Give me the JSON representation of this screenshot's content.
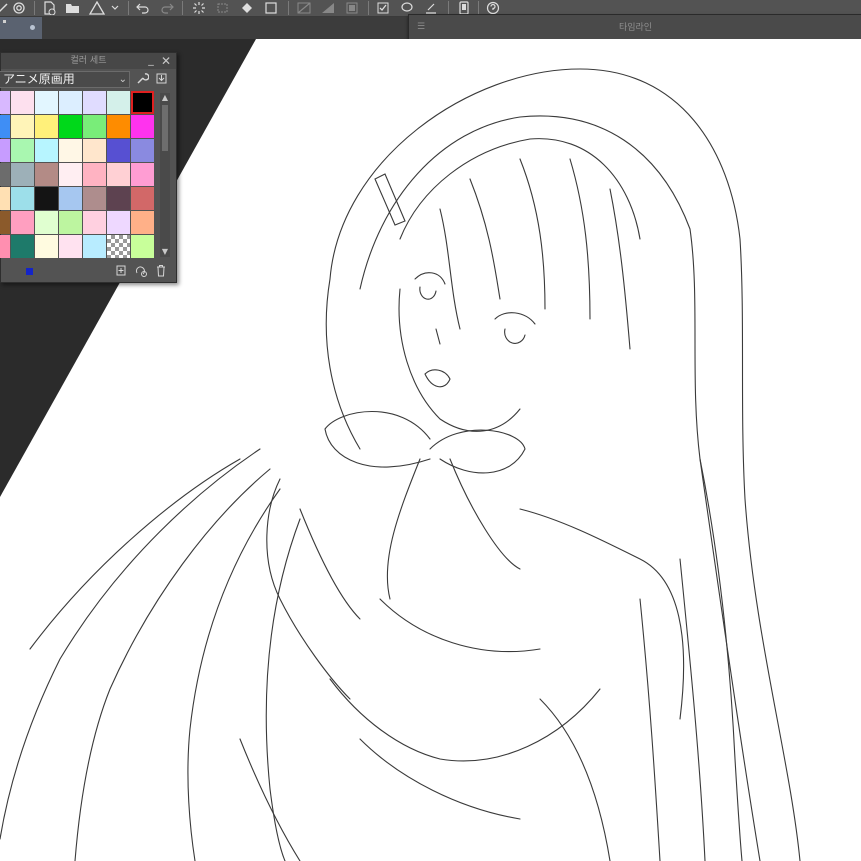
{
  "timeline": {
    "title": "타임라인"
  },
  "palette": {
    "title": "컬러 세트",
    "set_name": "アニメ原画用",
    "current_color": "#1424c8",
    "swatches": [
      "#d8b8ff",
      "#fde0ee",
      "#e2f6ff",
      "#dceeff",
      "#e0dcff",
      "#d4f0ea",
      "#000000",
      "#3f8ef5",
      "#fff4b8",
      "#fff07a",
      "#00d81a",
      "#79ed79",
      "#fe8c00",
      "#ff33ee",
      "#c79cff",
      "#a9f7b0",
      "#b7f5ff",
      "#fff7e6",
      "#ffe6cc",
      "#5750d2",
      "#8a8ae0",
      "#6c6c6c",
      "#9db0b8",
      "#b38b86",
      "#ffeef2",
      "#ffb3c2",
      "#ffd0d4",
      "#ff9dd3",
      "#ffe0b3",
      "#9ddfea",
      "#141414",
      "#a6c7f0",
      "#ae8d8d",
      "#5d4250",
      "#d26868",
      "#8b5a2b",
      "#ff9fc0",
      "#e0ffd0",
      "#bdf5a0",
      "#ffd0e0",
      "#eed8ff",
      "#ffb088",
      "#ff8fb0",
      "#1e7a6a",
      "#fffbe0",
      "#ffe2f0",
      "#b8ecff",
      "transparent",
      "#c8ff9a"
    ],
    "selected_index": 6
  },
  "icons": {
    "toolbar": [
      "pen-icon",
      "spiral-icon",
      "new-file-icon",
      "open-folder-icon",
      "export-icon",
      "dropdown-icon",
      "undo-icon",
      "redo-icon",
      "loading-icon",
      "transform-icon",
      "fill-icon",
      "crop-icon",
      "ruler-icon",
      "grid-icon",
      "layer-mask-icon",
      "check-icon",
      "lasso-icon",
      "align-icon",
      "device-icon",
      "help-icon"
    ],
    "palette": [
      "wrench-icon",
      "import-icon",
      "add-color-icon",
      "replace-color-icon",
      "trash-icon"
    ]
  }
}
